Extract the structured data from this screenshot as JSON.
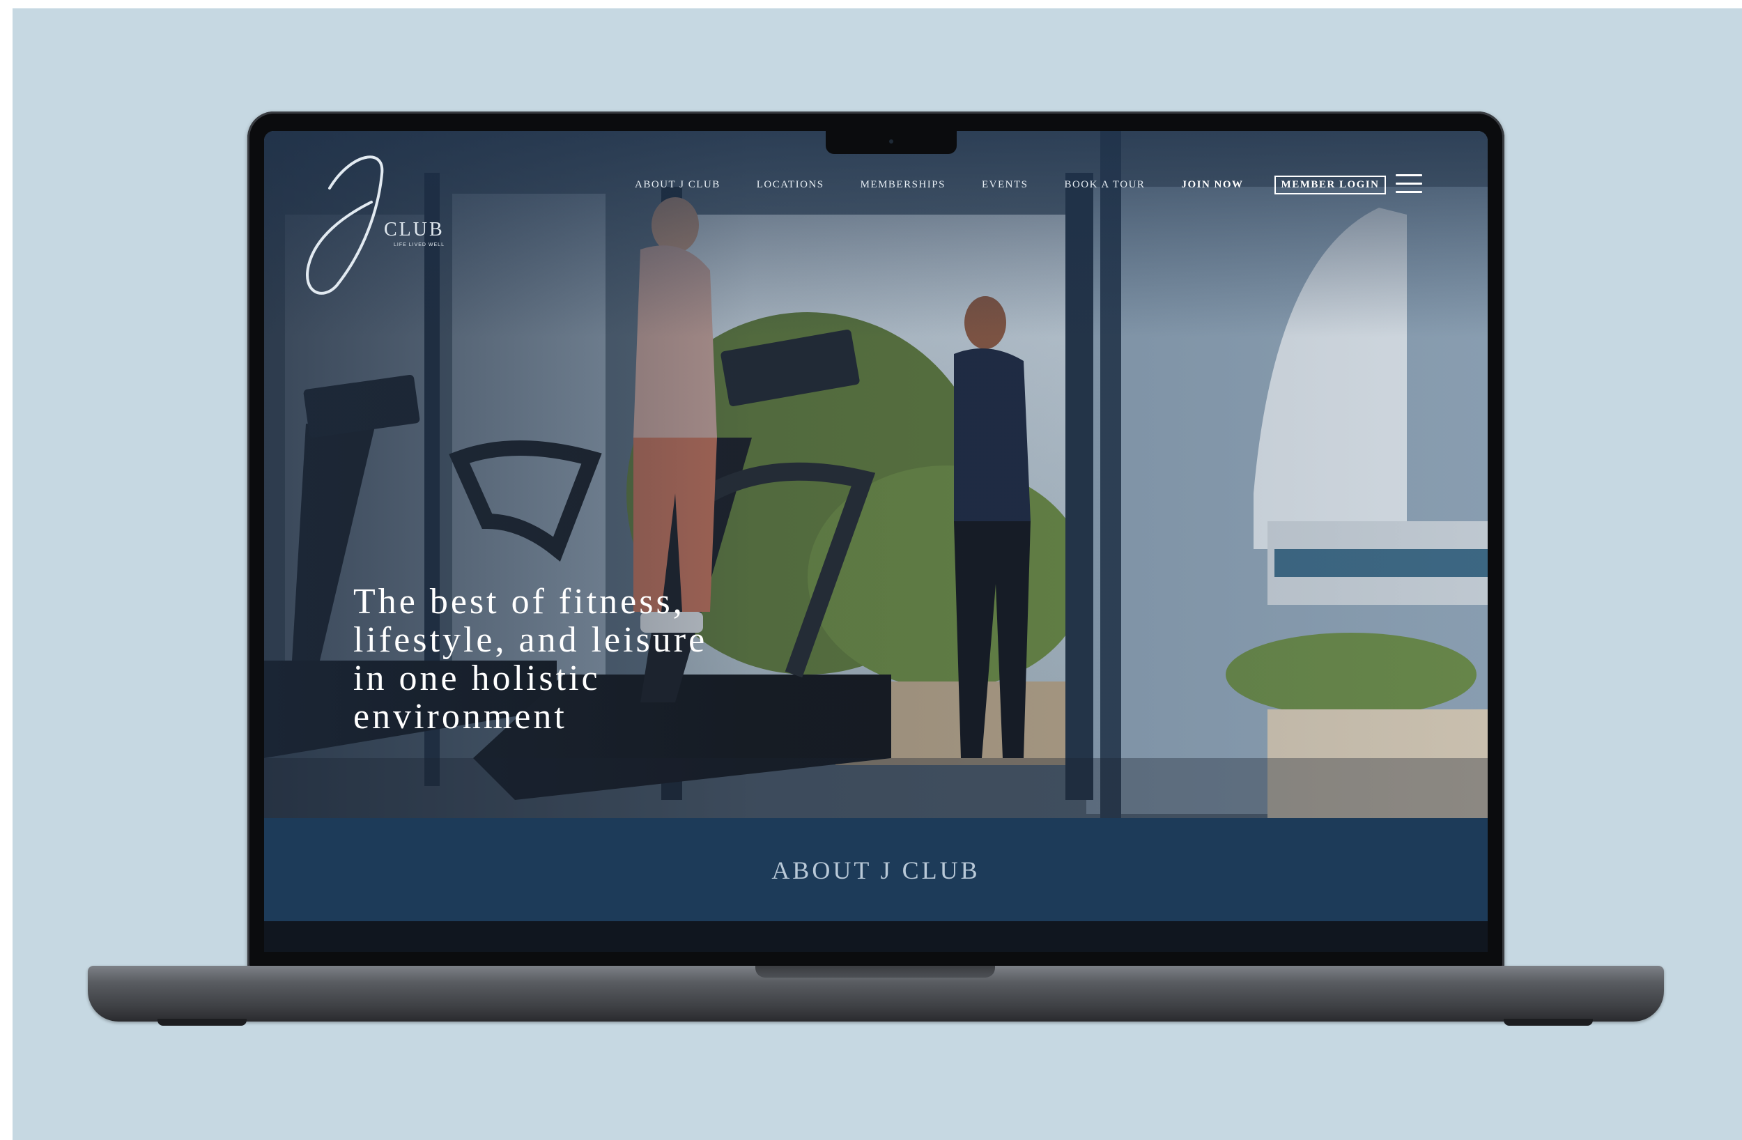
{
  "site": {
    "logo": {
      "letter": "J",
      "wordmark": "CLUB",
      "tagline": "LIFE LIVED WELL"
    },
    "nav": {
      "items": [
        {
          "label": "ABOUT J CLUB"
        },
        {
          "label": "LOCATIONS"
        },
        {
          "label": "MEMBERSHIPS"
        },
        {
          "label": "EVENTS"
        },
        {
          "label": "BOOK A TOUR"
        }
      ],
      "join_label": "JOIN NOW",
      "login_label": "MEMBER LOGIN",
      "menu_icon": "hamburger-menu-icon"
    },
    "hero": {
      "lines": [
        "The best of fitness,",
        "lifestyle, and leisure",
        "in one holistic",
        "environment"
      ]
    },
    "about": {
      "title": "ABOUT J CLUB"
    }
  },
  "colors": {
    "backdrop": "#c6d8e2",
    "about_band": "#1d3b59",
    "about_text": "#b9c9d8",
    "hero_text": "#ffffff"
  }
}
